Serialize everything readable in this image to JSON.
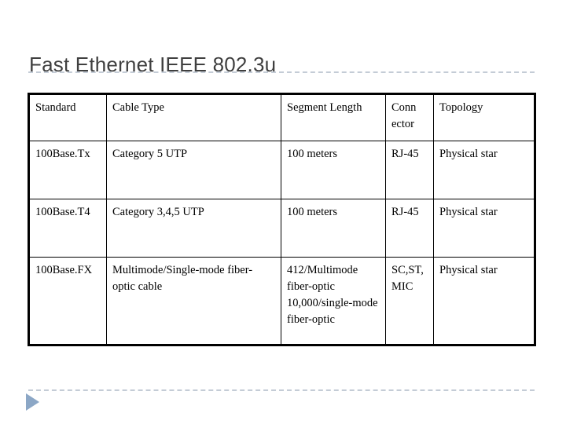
{
  "slide": {
    "title": "Fast Ethernet IEEE 802.3u"
  },
  "table": {
    "columns": [
      "Standard",
      "Cable Type",
      "Segment Length",
      "Conn ector",
      "Topology"
    ],
    "rows": [
      {
        "standard": "100Base.Tx",
        "cable_type": "Category 5 UTP",
        "segment_length": "100 meters",
        "connector": "RJ-45",
        "topology": "Physical star"
      },
      {
        "standard": "100Base.T4",
        "cable_type": "Category 3,4,5 UTP",
        "segment_length": "100 meters",
        "connector": "RJ-45",
        "topology": "Physical star"
      },
      {
        "standard": "100Base.FX",
        "cable_type": "Multimode/Single-mode fiber-optic cable",
        "segment_length": "412/Multimode fiber-optic 10,000/single-mode fiber-optic",
        "connector": "SC,ST,MIC",
        "topology": "Physical star"
      }
    ]
  },
  "navigation": {
    "next_arrow": "play-arrow"
  },
  "colors": {
    "title_text": "#3f3f3f",
    "rule": "#c4ccd6",
    "arrow": "#8ca7c6",
    "table_border": "#000000",
    "background": "#ffffff"
  }
}
